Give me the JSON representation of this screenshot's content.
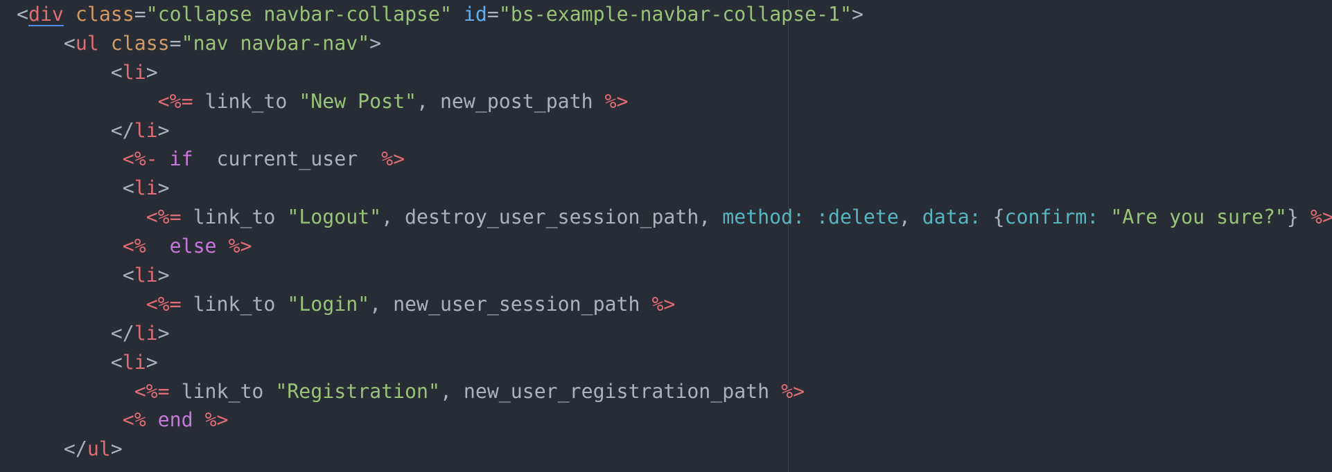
{
  "editor": {
    "lines": [
      [
        {
          "t": "<",
          "c": "punct"
        },
        {
          "t": "div",
          "c": "tag",
          "u": true
        },
        {
          "t": " ",
          "c": "plain"
        },
        {
          "t": "class",
          "c": "attr"
        },
        {
          "t": "=",
          "c": "punct"
        },
        {
          "t": "\"collapse navbar-collapse\"",
          "c": "string"
        },
        {
          "t": " ",
          "c": "plain"
        },
        {
          "t": "id",
          "c": "id"
        },
        {
          "t": "=",
          "c": "punct"
        },
        {
          "t": "\"bs-example-navbar-collapse-1\"",
          "c": "string"
        },
        {
          "t": ">",
          "c": "punct"
        }
      ],
      [
        {
          "t": "    <",
          "c": "punct"
        },
        {
          "t": "ul",
          "c": "tag"
        },
        {
          "t": " ",
          "c": "plain"
        },
        {
          "t": "class",
          "c": "attr"
        },
        {
          "t": "=",
          "c": "punct"
        },
        {
          "t": "\"nav navbar-nav\"",
          "c": "string"
        },
        {
          "t": ">",
          "c": "punct"
        }
      ],
      [
        {
          "t": "        <",
          "c": "punct"
        },
        {
          "t": "li",
          "c": "tag"
        },
        {
          "t": ">",
          "c": "punct"
        }
      ],
      [
        {
          "t": "            ",
          "c": "plain"
        },
        {
          "t": "<%=",
          "c": "erb"
        },
        {
          "t": " link_to ",
          "c": "plain"
        },
        {
          "t": "\"New Post\"",
          "c": "string"
        },
        {
          "t": ", new_post_path ",
          "c": "plain"
        },
        {
          "t": "%>",
          "c": "erb"
        }
      ],
      [
        {
          "t": "        </",
          "c": "punct"
        },
        {
          "t": "li",
          "c": "tag"
        },
        {
          "t": ">",
          "c": "punct"
        }
      ],
      [
        {
          "t": "         ",
          "c": "plain"
        },
        {
          "t": "<%-",
          "c": "erb"
        },
        {
          "t": " ",
          "c": "plain"
        },
        {
          "t": "if",
          "c": "keyword"
        },
        {
          "t": "  current_user  ",
          "c": "plain"
        },
        {
          "t": "%>",
          "c": "erb"
        }
      ],
      [
        {
          "t": "         <",
          "c": "punct"
        },
        {
          "t": "li",
          "c": "tag"
        },
        {
          "t": ">",
          "c": "punct"
        }
      ],
      [
        {
          "t": "           ",
          "c": "plain"
        },
        {
          "t": "<%=",
          "c": "erb"
        },
        {
          "t": " link_to ",
          "c": "plain"
        },
        {
          "t": "\"Logout\"",
          "c": "string"
        },
        {
          "t": ", destroy_user_session_path, ",
          "c": "plain"
        },
        {
          "t": "method:",
          "c": "symbol"
        },
        {
          "t": " ",
          "c": "plain"
        },
        {
          "t": ":delete",
          "c": "symbol"
        },
        {
          "t": ", ",
          "c": "plain"
        },
        {
          "t": "data:",
          "c": "symbol"
        },
        {
          "t": " {",
          "c": "plain"
        },
        {
          "t": "confirm:",
          "c": "symbol"
        },
        {
          "t": " ",
          "c": "plain"
        },
        {
          "t": "\"Are you sure?\"",
          "c": "string"
        },
        {
          "t": "} ",
          "c": "plain"
        },
        {
          "t": "%>",
          "c": "erb"
        }
      ],
      [
        {
          "t": "         ",
          "c": "plain"
        },
        {
          "t": "<%",
          "c": "erb"
        },
        {
          "t": "  ",
          "c": "plain"
        },
        {
          "t": "else",
          "c": "keyword"
        },
        {
          "t": " ",
          "c": "plain"
        },
        {
          "t": "%>",
          "c": "erb"
        }
      ],
      [
        {
          "t": "         <",
          "c": "punct"
        },
        {
          "t": "li",
          "c": "tag"
        },
        {
          "t": ">",
          "c": "punct"
        }
      ],
      [
        {
          "t": "           ",
          "c": "plain"
        },
        {
          "t": "<%=",
          "c": "erb"
        },
        {
          "t": " link_to ",
          "c": "plain"
        },
        {
          "t": "\"Login\"",
          "c": "string"
        },
        {
          "t": ", new_user_session_path ",
          "c": "plain"
        },
        {
          "t": "%>",
          "c": "erb"
        }
      ],
      [
        {
          "t": "        </",
          "c": "punct"
        },
        {
          "t": "li",
          "c": "tag"
        },
        {
          "t": ">",
          "c": "punct"
        }
      ],
      [
        {
          "t": "        <",
          "c": "punct"
        },
        {
          "t": "li",
          "c": "tag"
        },
        {
          "t": ">",
          "c": "punct"
        }
      ],
      [
        {
          "t": "          ",
          "c": "plain"
        },
        {
          "t": "<%=",
          "c": "erb"
        },
        {
          "t": " link_to ",
          "c": "plain"
        },
        {
          "t": "\"Registration\"",
          "c": "string"
        },
        {
          "t": ", new_user_registration_path ",
          "c": "plain"
        },
        {
          "t": "%>",
          "c": "erb"
        }
      ],
      [
        {
          "t": "         ",
          "c": "plain"
        },
        {
          "t": "<%",
          "c": "erb"
        },
        {
          "t": " ",
          "c": "plain"
        },
        {
          "t": "end",
          "c": "keyword"
        },
        {
          "t": " ",
          "c": "plain"
        },
        {
          "t": "%>",
          "c": "erb"
        }
      ],
      [
        {
          "t": "    </",
          "c": "punct"
        },
        {
          "t": "ul",
          "c": "tag"
        },
        {
          "t": ">",
          "c": "punct"
        }
      ]
    ]
  }
}
